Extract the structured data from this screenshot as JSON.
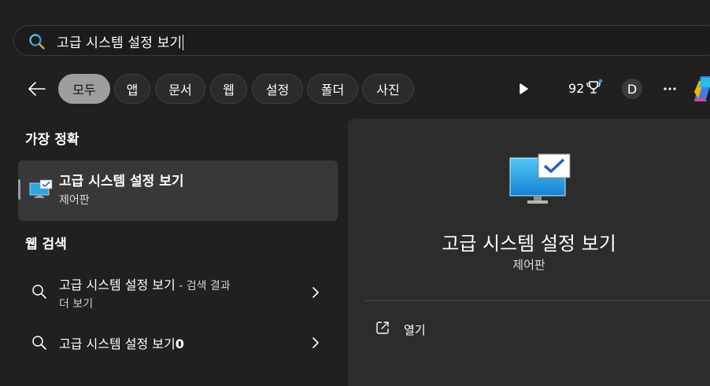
{
  "search": {
    "query": "고급 시스템 설정 보기"
  },
  "filters": {
    "back_label": "Back",
    "chips": [
      "모두",
      "앱",
      "문서",
      "웹",
      "설정",
      "폴더",
      "사진"
    ],
    "active": "모두"
  },
  "toolbar": {
    "points": "92",
    "avatar_initial": "D"
  },
  "best_match": {
    "heading": "가장 정확",
    "title": "고급 시스템 설정 보기",
    "subtitle": "제어판"
  },
  "web_search": {
    "heading": "웹 검색",
    "items": [
      {
        "title": "고급 시스템 설정 보기",
        "suffix": " - 검색 결과",
        "line2": "더 보기"
      },
      {
        "title": "고급 시스템 설정 보기",
        "suffix_bold": "0"
      }
    ]
  },
  "detail": {
    "title": "고급 시스템 설정 보기",
    "subtitle": "제어판",
    "actions": [
      {
        "label": "열기",
        "icon": "open-external-icon"
      }
    ]
  },
  "colors": {
    "background": "#202020",
    "card": "#383838",
    "pane": "#2c2c2c",
    "active_chip": "#9e9e9e"
  }
}
